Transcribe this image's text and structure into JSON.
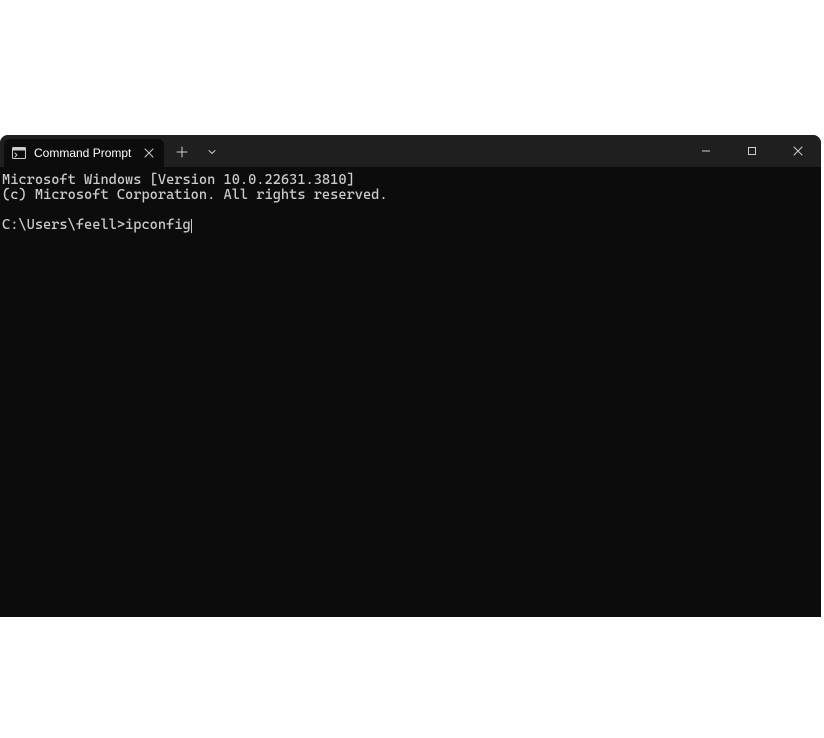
{
  "window": {
    "tab": {
      "title": "Command Prompt"
    }
  },
  "terminal": {
    "line1": "Microsoft Windows [Version 10.0.22631.3810]",
    "line2": "(c) Microsoft Corporation. All rights reserved.",
    "prompt": "C:\\Users\\feell>",
    "command": "ipconfig"
  }
}
